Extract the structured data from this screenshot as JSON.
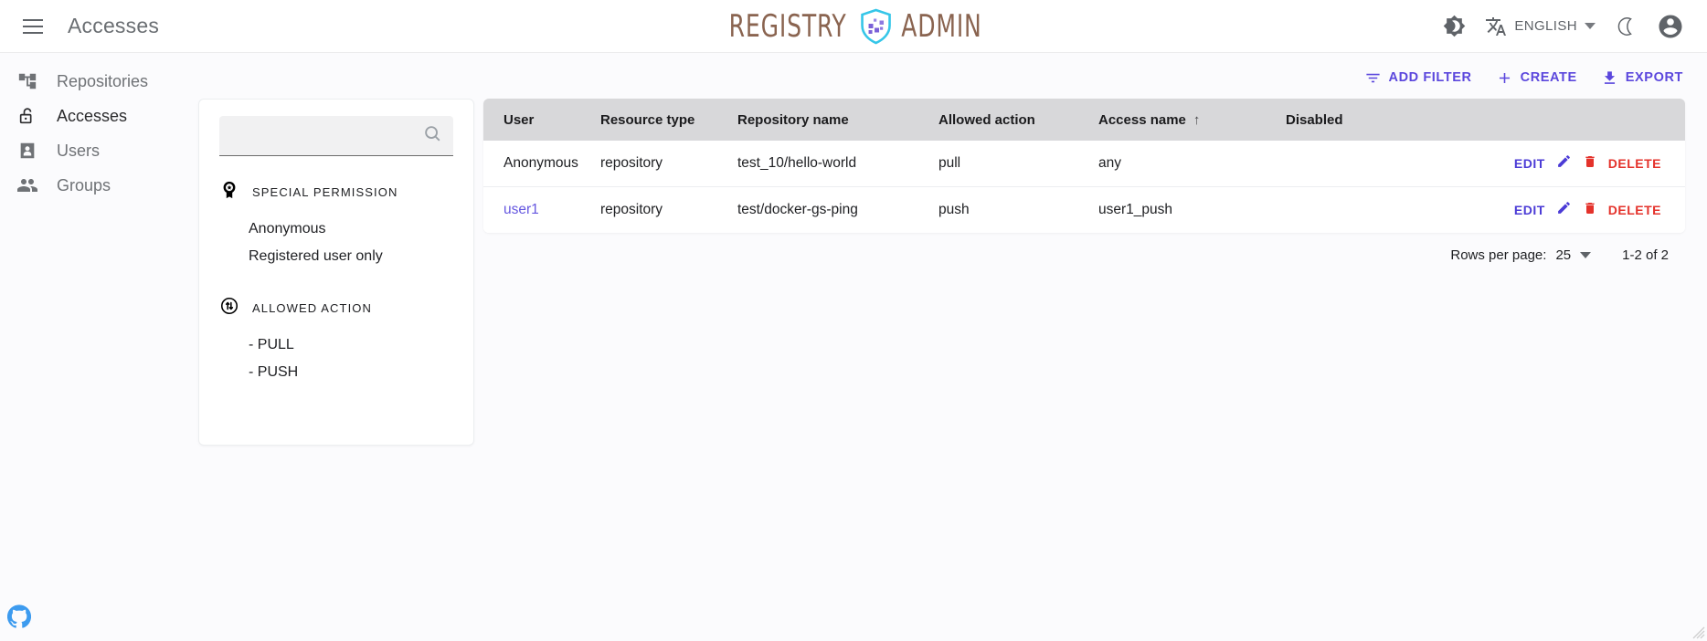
{
  "appbar": {
    "menu_icon": "hamburger-menu-icon",
    "title": "Accesses",
    "logo": {
      "left_text": "REGISTRY",
      "right_text": "ADMIN",
      "shield_icon": "shield-registry-icon"
    },
    "right": {
      "dark_mode_icon": "brightness-contrast-icon",
      "translate_icon": "translate-icon",
      "language_label": "ENGLISH",
      "language_chevron_icon": "chevron-down-icon",
      "theme_moon_icon": "crescent-moon-icon",
      "account_icon": "account-circle-icon"
    }
  },
  "sidebar": {
    "items": [
      {
        "label": "Repositories",
        "icon": "account-tree-icon",
        "active": false
      },
      {
        "label": "Accesses",
        "icon": "lock-open-icon",
        "active": true
      },
      {
        "label": "Users",
        "icon": "person-box-icon",
        "active": false
      },
      {
        "label": "Groups",
        "icon": "people-icon",
        "active": false
      }
    ]
  },
  "toolbar": {
    "add_filter_label": "ADD FILTER",
    "add_filter_icon": "filter-list-icon",
    "create_label": "CREATE",
    "create_icon": "plus-icon",
    "export_label": "EXPORT",
    "export_icon": "download-icon"
  },
  "filter_panel": {
    "search": {
      "value": "",
      "placeholder": "",
      "icon": "search-icon"
    },
    "groups": [
      {
        "title": "SPECIAL PERMISSION",
        "icon": "badge-star-icon",
        "items": [
          "Anonymous",
          "Registered user only"
        ]
      },
      {
        "title": "ALLOWED ACTION",
        "icon": "swap-vert-circle-icon",
        "items": [
          "- PULL",
          "- PUSH"
        ]
      }
    ]
  },
  "table": {
    "columns": [
      {
        "label": "User"
      },
      {
        "label": "Resource type"
      },
      {
        "label": "Repository name"
      },
      {
        "label": "Allowed action"
      },
      {
        "label": "Access name",
        "sorted": "asc",
        "sort_icon": "arrow-up-icon"
      },
      {
        "label": "Disabled"
      }
    ],
    "rows": [
      {
        "user": "Anonymous",
        "user_is_link": false,
        "resource_type": "repository",
        "repository_name": "test_10/hello-world",
        "allowed_action": "pull",
        "access_name": "any",
        "disabled": "",
        "edit_label": "EDIT",
        "delete_label": "DELETE"
      },
      {
        "user": "user1",
        "user_is_link": true,
        "resource_type": "repository",
        "repository_name": "test/docker-gs-ping",
        "allowed_action": "push",
        "access_name": "user1_push",
        "disabled": "",
        "edit_label": "EDIT",
        "delete_label": "DELETE"
      }
    ]
  },
  "pagination": {
    "rows_per_page_label": "Rows per page:",
    "rows_per_page_value": "25",
    "dropdown_icon": "chevron-down-icon",
    "range_label": "1-2 of 2"
  },
  "footer": {
    "github_icon": "github-icon"
  },
  "colors": {
    "accent_purple": "#5b47dd",
    "delete_red": "#e4322b",
    "link_purple": "#6557e0",
    "logo_brown": "#8a6450",
    "shield_cyan": "#35c6e8",
    "github_blue": "#3d9bef",
    "header_gray": "#d8d8da",
    "page_bg": "#fbfbfd"
  }
}
